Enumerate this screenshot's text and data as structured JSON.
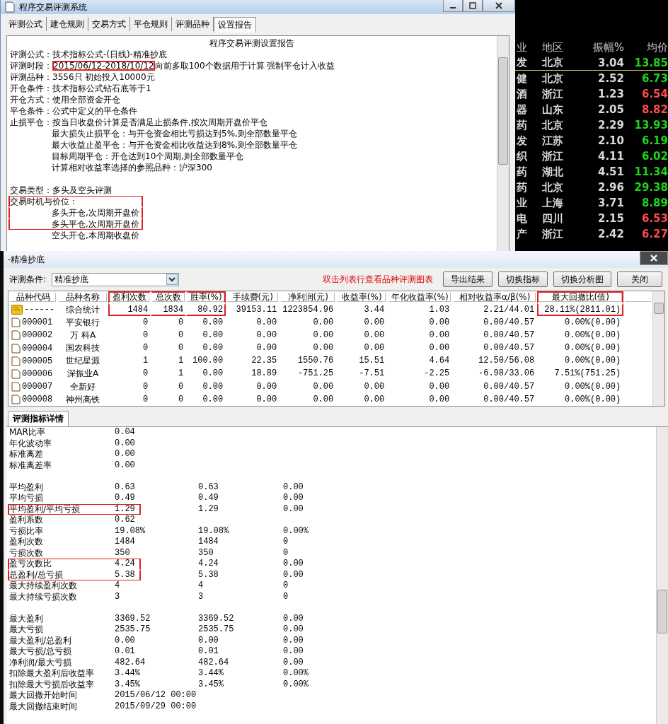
{
  "main_window": {
    "title": "程序交易评测系统",
    "tabs": [
      {
        "label": "评测公式",
        "selected": false
      },
      {
        "label": "建仓规则",
        "selected": false
      },
      {
        "label": "交易方式",
        "selected": false
      },
      {
        "label": "平仓规则",
        "selected": false
      },
      {
        "label": "评测品种",
        "selected": false
      },
      {
        "label": "设置报告",
        "selected": true
      }
    ],
    "report": {
      "title": "程序交易评测设置报告",
      "lines": [
        {
          "kind": "line",
          "label": "评测公式：",
          "text": "技术指标公式-(日线)-精准抄底",
          "highlighted": false
        },
        {
          "kind": "line",
          "label": "评测时段：",
          "value": "2015/06/12-2018/10/12",
          "value_highlighted": true,
          "text": "向前多取100个数据用于计算 强制平仓计入收益",
          "highlighted": false
        },
        {
          "kind": "line",
          "label": "评测品种：",
          "text": "3556只 初始投入10000元",
          "highlighted": false
        },
        {
          "kind": "line",
          "label": "开仓条件：",
          "text": "技术指标公式钻石底等于1",
          "highlighted": false
        },
        {
          "kind": "line",
          "label": "开仓方式：",
          "text": "使用全部资金开仓",
          "highlighted": false
        },
        {
          "kind": "line",
          "label": "平仓条件：",
          "text": "公式中定义的平仓条件",
          "highlighted": false
        },
        {
          "kind": "line",
          "label": "止损平仓：",
          "text": "按当日收盘价计算是否满足止损条件,按次周期开盘价平仓",
          "highlighted": false,
          "children": [
            {
              "kind": "line",
              "text": "最大损失止损平仓：与开仓资金相比亏损达到5%,则全部数量平仓",
              "highlighted": false
            },
            {
              "kind": "line",
              "text": "最大收益止盈平仓：与开仓资金相比收益达到8%,则全部数量平仓",
              "highlighted": false
            },
            {
              "kind": "line",
              "text": "目标周期平仓：开仓达到10个周期,则全部数量平仓",
              "highlighted": false
            },
            {
              "kind": "line",
              "text": "计算相对收益率选择的参照品种：沪深300",
              "highlighted": false
            }
          ]
        },
        {
          "kind": "blank",
          "highlighted": false
        },
        {
          "kind": "line",
          "label": "交易类型：",
          "text": "多头及空头评测",
          "highlighted": false
        },
        {
          "kind": "line",
          "label": "交易时机与价位：",
          "highlighted": true,
          "children": [
            {
              "kind": "line",
              "text": "多头开仓,次周期开盘价",
              "highlighted": true
            },
            {
              "kind": "line",
              "text": "多头平仓,次周期开盘价",
              "highlighted": true
            },
            {
              "kind": "line",
              "text": "空头开仓,本周期收盘价",
              "highlighted": false
            }
          ]
        }
      ]
    }
  },
  "stock_panel": {
    "columns": [
      "业",
      "地区",
      "振幅%",
      "均价"
    ],
    "rows": [
      {
        "industry": "发",
        "region": "北京",
        "amplitude": "3.04",
        "price": "13.85",
        "color": "#1ed21e",
        "selected": true
      },
      {
        "industry": "健",
        "region": "北京",
        "amplitude": "2.52",
        "price": "6.73",
        "color": "#1ed21e",
        "selected": false
      },
      {
        "industry": "酒",
        "region": "浙江",
        "amplitude": "1.23",
        "price": "6.54",
        "color": "#ff4a4a",
        "selected": false
      },
      {
        "industry": "器",
        "region": "山东",
        "amplitude": "2.05",
        "price": "8.82",
        "color": "#ff4a4a",
        "selected": false
      },
      {
        "industry": "药",
        "region": "北京",
        "amplitude": "2.29",
        "price": "13.93",
        "color": "#1ed21e",
        "selected": false
      },
      {
        "industry": "发",
        "region": "江苏",
        "amplitude": "2.10",
        "price": "6.19",
        "color": "#1ed21e",
        "selected": false
      },
      {
        "industry": "织",
        "region": "浙江",
        "amplitude": "4.11",
        "price": "6.02",
        "color": "#1ed21e",
        "selected": false
      },
      {
        "industry": "药",
        "region": "湖北",
        "amplitude": "4.51",
        "price": "11.34",
        "color": "#1ed21e",
        "selected": false
      },
      {
        "industry": "药",
        "region": "北京",
        "amplitude": "2.96",
        "price": "29.38",
        "color": "#1ed21e",
        "selected": false
      },
      {
        "industry": "业",
        "region": "上海",
        "amplitude": "3.71",
        "price": "8.89",
        "color": "#1ed21e",
        "selected": false
      },
      {
        "industry": "电",
        "region": "四川",
        "amplitude": "2.15",
        "price": "6.53",
        "color": "#ff4a4a",
        "selected": false
      },
      {
        "industry": "产",
        "region": "浙江",
        "amplitude": "2.42",
        "price": "6.27",
        "color": "#ff4a4a",
        "selected": false
      }
    ]
  },
  "dialog": {
    "title": "-精准抄底",
    "condition_label": "评测条件:",
    "condition": "精准抄底",
    "hint": "双击列表行查看品种评测图表",
    "buttons": [
      "导出结果",
      "切换指标",
      "切换分析图",
      "关闭"
    ],
    "table": {
      "columns": [
        {
          "label": "品种代码",
          "highlighted": false
        },
        {
          "label": "品种名称",
          "highlighted": false
        },
        {
          "label": "盈利次数",
          "highlighted": true
        },
        {
          "label": "总次数",
          "highlighted": true
        },
        {
          "label": "胜率(%)",
          "highlighted": true
        },
        {
          "label": "手续费(元)",
          "highlighted": false
        },
        {
          "label": "净利润(元)",
          "highlighted": false
        },
        {
          "label": "收益率(%)",
          "highlighted": false
        },
        {
          "label": "年化收益率(%)",
          "highlighted": false
        },
        {
          "label": "相对收益率α/β(%)",
          "highlighted": false
        },
        {
          "label": "最大回撤比(值)",
          "highlighted": true
        }
      ],
      "rows": [
        {
          "kind": "summary",
          "highlighted": true,
          "cells": [
            "------",
            "综合统计",
            "1484",
            "1834",
            "80.92",
            "39153.11",
            "1223854.96",
            "3.44",
            "1.03",
            "2.21/44.01",
            "28.11%(2811.01)"
          ]
        },
        {
          "kind": "stock",
          "highlighted": false,
          "cells": [
            "000001",
            "平安银行",
            "0",
            "0",
            "0.00",
            "0.00",
            "0.00",
            "0.00",
            "0.00",
            "0.00/40.57",
            "0.00%(0.00)"
          ]
        },
        {
          "kind": "stock",
          "highlighted": false,
          "cells": [
            "000002",
            "万 科A",
            "0",
            "0",
            "0.00",
            "0.00",
            "0.00",
            "0.00",
            "0.00",
            "0.00/40.57",
            "0.00%(0.00)"
          ]
        },
        {
          "kind": "stock",
          "highlighted": false,
          "cells": [
            "000004",
            "国农科技",
            "0",
            "0",
            "0.00",
            "0.00",
            "0.00",
            "0.00",
            "0.00",
            "0.00/40.57",
            "0.00%(0.00)"
          ]
        },
        {
          "kind": "stock",
          "highlighted": false,
          "cells": [
            "000005",
            "世纪星源",
            "1",
            "1",
            "100.00",
            "22.35",
            "1550.76",
            "15.51",
            "4.64",
            "12.50/56.08",
            "0.00%(0.00)"
          ]
        },
        {
          "kind": "stock",
          "highlighted": false,
          "cells": [
            "000006",
            "深振业A",
            "0",
            "1",
            "0.00",
            "18.89",
            "-751.25",
            "-7.51",
            "-2.25",
            "-6.98/33.06",
            "7.51%(751.25)"
          ]
        },
        {
          "kind": "stock",
          "highlighted": false,
          "cells": [
            "000007",
            "全新好",
            "0",
            "0",
            "0.00",
            "0.00",
            "0.00",
            "0.00",
            "0.00",
            "0.00/40.57",
            "0.00%(0.00)"
          ]
        },
        {
          "kind": "stock",
          "highlighted": false,
          "cells": [
            "000008",
            "神州高铁",
            "0",
            "0",
            "0.00",
            "0.00",
            "0.00",
            "0.00",
            "0.00",
            "0.00/40.57",
            "0.00%(0.00)"
          ]
        }
      ]
    }
  },
  "details": {
    "tab": {
      "label": "评测指标详情",
      "selected": true
    },
    "rows": [
      {
        "kind": "row",
        "label": "MAR比率",
        "values": [
          "0.04"
        ],
        "highlighted": false
      },
      {
        "kind": "row",
        "label": "年化波动率",
        "values": [
          "0.00"
        ],
        "highlighted": false
      },
      {
        "kind": "row",
        "label": "标准离差",
        "values": [
          "0.00"
        ],
        "highlighted": false
      },
      {
        "kind": "row",
        "label": "标准离差率",
        "values": [
          "0.00"
        ],
        "highlighted": false
      },
      {
        "kind": "blank",
        "highlighted": false
      },
      {
        "kind": "row",
        "label": "平均盈利",
        "values": [
          "0.63",
          "0.63",
          "0.00"
        ],
        "highlighted": false
      },
      {
        "kind": "row",
        "label": "平均亏损",
        "values": [
          "0.49",
          "0.49",
          "0.00"
        ],
        "highlighted": false
      },
      {
        "kind": "row",
        "label": "平均盈利/平均亏损",
        "values": [
          "1.29",
          "1.29",
          "0.00"
        ],
        "highlighted": true
      },
      {
        "kind": "row",
        "label": "盈利系数",
        "values": [
          "0.62"
        ],
        "highlighted": false
      },
      {
        "kind": "row",
        "label": "亏损比率",
        "values": [
          "19.08%",
          "19.08%",
          "0.00%"
        ],
        "highlighted": false
      },
      {
        "kind": "row",
        "label": "盈利次数",
        "values": [
          "1484",
          "1484",
          "0"
        ],
        "highlighted": false
      },
      {
        "kind": "row",
        "label": "亏损次数",
        "values": [
          "350",
          "350",
          "0"
        ],
        "highlighted": false
      },
      {
        "kind": "row",
        "label": "盈亏次数比",
        "values": [
          "4.24",
          "4.24",
          "0.00"
        ],
        "highlighted": true
      },
      {
        "kind": "row",
        "label": "总盈利/总亏损",
        "values": [
          "5.38",
          "5.38",
          "0.00"
        ],
        "highlighted": true
      },
      {
        "kind": "row",
        "label": "最大持续盈利次数",
        "values": [
          "4",
          "4",
          "0"
        ],
        "highlighted": false
      },
      {
        "kind": "row",
        "label": "最大持续亏损次数",
        "values": [
          "3",
          "3",
          "0"
        ],
        "highlighted": false
      },
      {
        "kind": "blank",
        "highlighted": false
      },
      {
        "kind": "row",
        "label": "最大盈利",
        "values": [
          "3369.52",
          "3369.52",
          "0.00"
        ],
        "highlighted": false
      },
      {
        "kind": "row",
        "label": "最大亏损",
        "values": [
          "2535.75",
          "2535.75",
          "0.00"
        ],
        "highlighted": false
      },
      {
        "kind": "row",
        "label": "最大盈利/总盈利",
        "values": [
          "0.00",
          "0.00",
          "0.00"
        ],
        "highlighted": false
      },
      {
        "kind": "row",
        "label": "最大亏损/总亏损",
        "values": [
          "0.01",
          "0.01",
          "0.00"
        ],
        "highlighted": false
      },
      {
        "kind": "row",
        "label": "净利润/最大亏损",
        "values": [
          "482.64",
          "482.64",
          "0.00"
        ],
        "highlighted": false
      },
      {
        "kind": "row",
        "label": "扣除最大盈利后收益率",
        "values": [
          "3.44%",
          "3.44%",
          "0.00%"
        ],
        "highlighted": false
      },
      {
        "kind": "row",
        "label": "扣除最大亏损后收益率",
        "values": [
          "3.45%",
          "3.45%",
          "0.00%"
        ],
        "highlighted": false
      },
      {
        "kind": "row",
        "label": "最大回撤开始时间",
        "values": [
          "2015/06/12 00:00"
        ],
        "highlighted": false
      },
      {
        "kind": "row",
        "label": "最大回撤结束时间",
        "values": [
          "2015/09/29 00:00"
        ],
        "highlighted": false
      }
    ]
  }
}
